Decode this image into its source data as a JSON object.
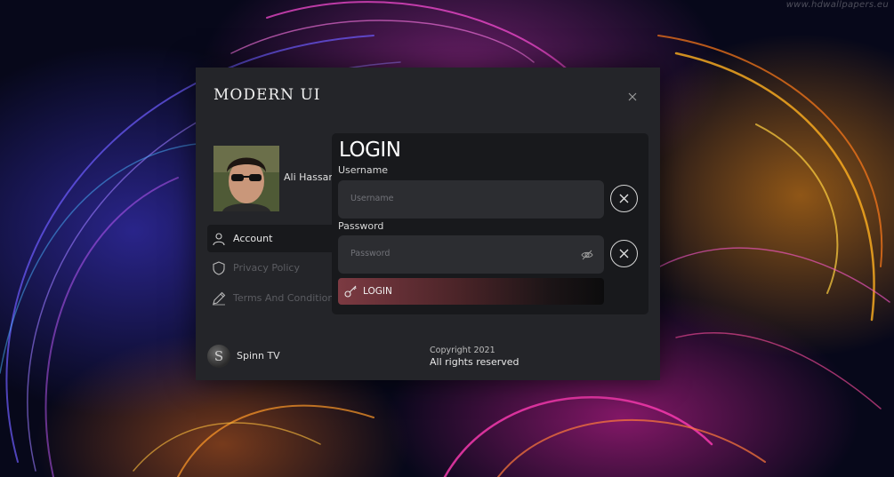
{
  "wallpaper": {
    "watermark": "www.hdwallpapers.eu"
  },
  "window": {
    "title": "MODERN UI",
    "close_icon": "close-icon"
  },
  "user": {
    "name": "Ali Hassan"
  },
  "nav": {
    "items": [
      {
        "label": "Account",
        "icon": "user-icon",
        "active": true
      },
      {
        "label": "Privacy Policy",
        "icon": "shield-icon",
        "active": false
      },
      {
        "label": "Terms And Conditions",
        "icon": "pencil-icon",
        "active": false
      }
    ]
  },
  "footer": {
    "logo_letter": "S",
    "brand": "Spinn TV",
    "copyright": "Copyright 2021",
    "rights": "All rights reserved"
  },
  "login": {
    "title": "LOGIN",
    "username_label": "Username",
    "username_placeholder": "Username",
    "username_value": "",
    "password_label": "Password",
    "password_placeholder": "Password",
    "password_value": "",
    "button_label": "LOGIN",
    "button_icon": "key-icon"
  },
  "colors": {
    "window_bg": "#242529",
    "panel_bg": "#18191c",
    "input_bg": "#2c2d31",
    "button_gradient_start": "#7c3a42",
    "text_primary": "#ffffff",
    "text_dim": "#5b5c61"
  }
}
